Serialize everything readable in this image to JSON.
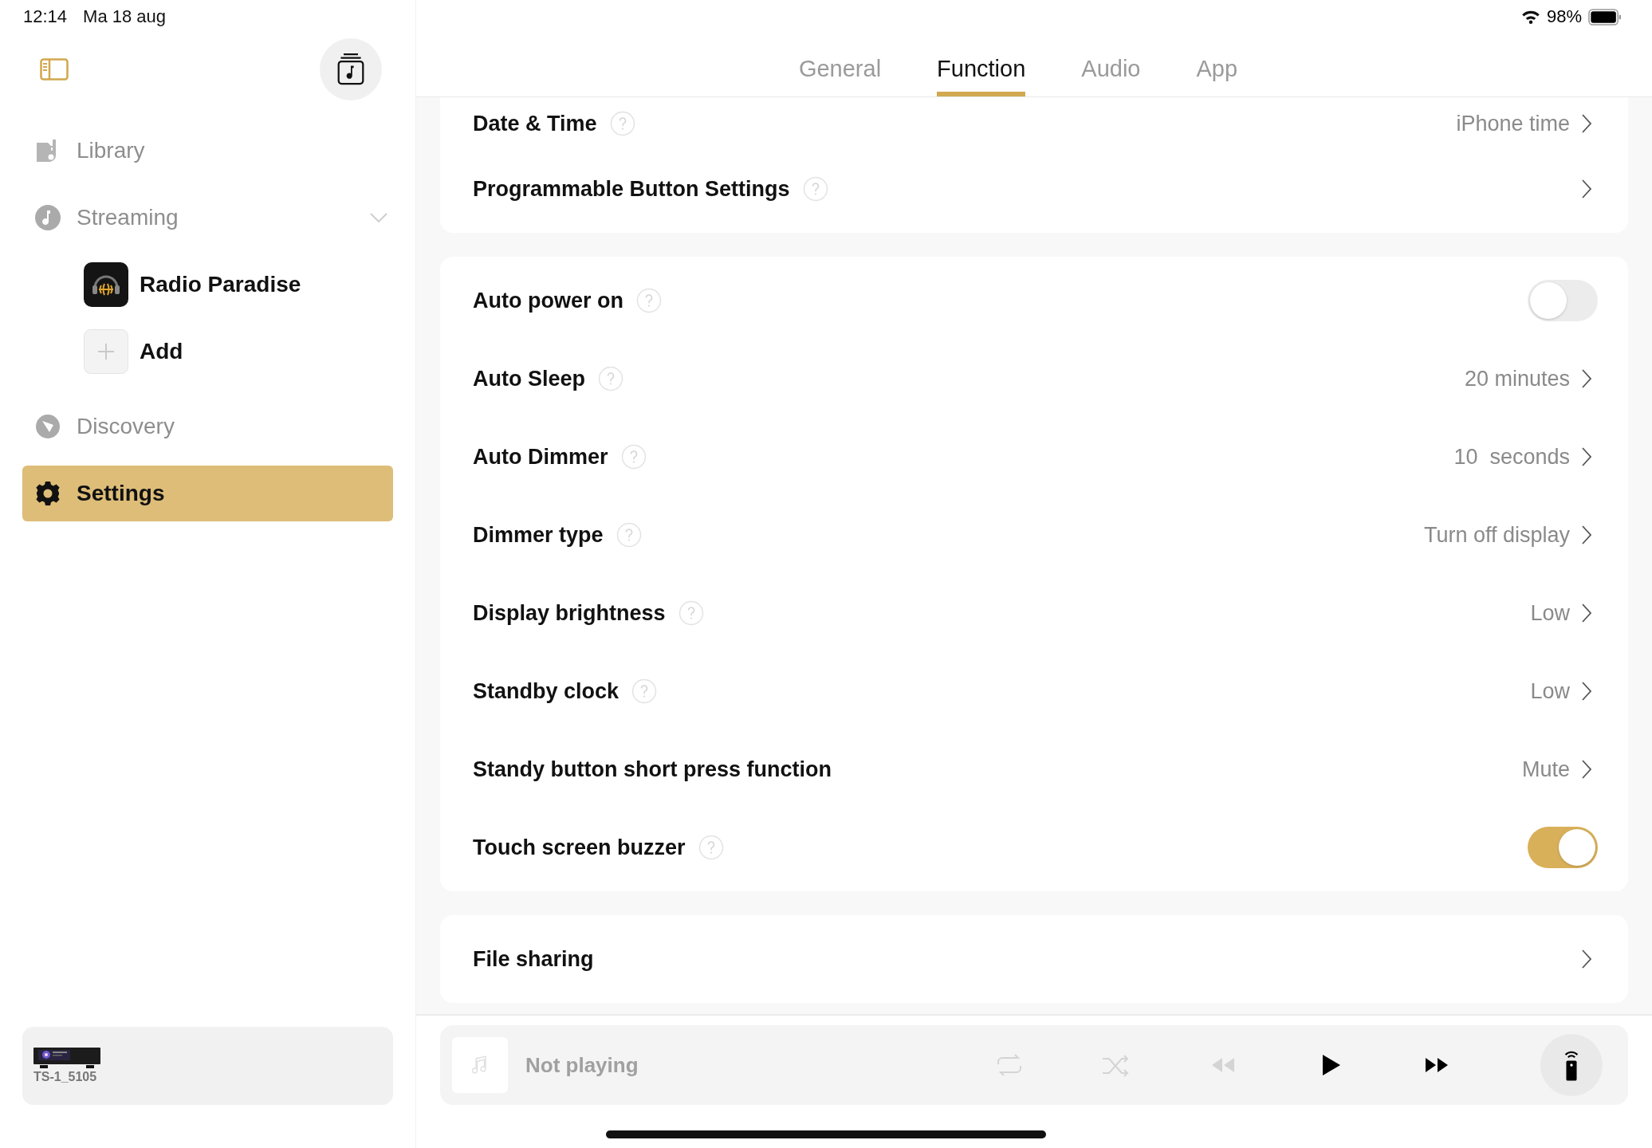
{
  "status_bar": {
    "time": "12:14",
    "date": "Ma 18 aug",
    "battery": "98%"
  },
  "sidebar": {
    "items": [
      {
        "kind": "library",
        "label": "Library",
        "selected": false
      },
      {
        "kind": "streaming",
        "label": "Streaming",
        "selected": false,
        "expanded": true,
        "children": [
          {
            "kind": "station",
            "label": "Radio Paradise"
          },
          {
            "kind": "add",
            "label": "Add"
          }
        ]
      },
      {
        "kind": "discovery",
        "label": "Discovery",
        "selected": false
      },
      {
        "kind": "settings",
        "label": "Settings",
        "selected": true
      }
    ]
  },
  "device": {
    "name": "TS-1_5105"
  },
  "tabs": [
    {
      "label": "General",
      "selected": false
    },
    {
      "label": "Function",
      "selected": true
    },
    {
      "label": "Audio",
      "selected": false
    },
    {
      "label": "App",
      "selected": false
    }
  ],
  "sections": [
    {
      "rows": [
        {
          "kind": "value",
          "label": "Date & Time",
          "help": true,
          "value": "iPhone time"
        },
        {
          "kind": "link",
          "label": "Programmable Button Settings",
          "help": true
        }
      ]
    },
    {
      "rows": [
        {
          "kind": "toggle",
          "label": "Auto power on",
          "help": true,
          "on": false
        },
        {
          "kind": "value",
          "label": "Auto Sleep",
          "help": true,
          "value": "20 minutes"
        },
        {
          "kind": "value",
          "label": "Auto Dimmer",
          "help": true,
          "value": "10  seconds"
        },
        {
          "kind": "value",
          "label": "Dimmer type",
          "help": true,
          "value": "Turn off display"
        },
        {
          "kind": "value",
          "label": "Display brightness",
          "help": true,
          "value": "Low"
        },
        {
          "kind": "value",
          "label": "Standby clock",
          "help": true,
          "value": "Low"
        },
        {
          "kind": "value",
          "label": "Standy button short press function",
          "help": false,
          "value": "Mute"
        },
        {
          "kind": "toggle",
          "label": "Touch screen buzzer",
          "help": true,
          "on": true
        }
      ]
    },
    {
      "rows": [
        {
          "kind": "link",
          "label": "File sharing",
          "help": false
        }
      ]
    }
  ],
  "player": {
    "title": "Not playing",
    "controls": [
      {
        "kind": "repeat",
        "disabled": true
      },
      {
        "kind": "shuffle",
        "disabled": true
      },
      {
        "kind": "previous",
        "disabled": true
      },
      {
        "kind": "play",
        "disabled": false
      },
      {
        "kind": "next",
        "disabled": false
      }
    ]
  }
}
